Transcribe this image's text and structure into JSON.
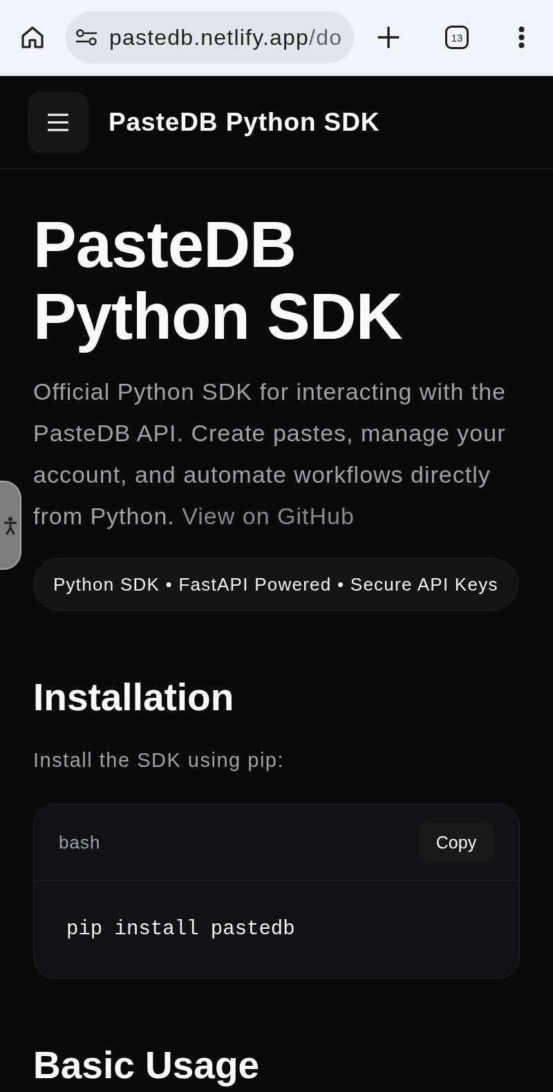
{
  "browser": {
    "url": {
      "host": "pastedb.netlify.app",
      "path": "/do"
    },
    "tab_count": "13"
  },
  "header": {
    "title": "PasteDB Python SDK"
  },
  "hero": {
    "title": "PasteDB Python SDK",
    "description": "Official Python SDK for interacting with the PasteDB API. Create pastes, manage your account, and automate workflows directly from Python.",
    "link": "View on GitHub",
    "badge": "Python SDK • FastAPI Powered • Secure API Keys"
  },
  "sections": [
    {
      "heading": "Installation",
      "text": "Install the SDK using pip:",
      "code": {
        "language": "bash",
        "copy_label": "Copy",
        "lines": [
          "pip install pastedb"
        ]
      }
    },
    {
      "heading": "Basic Usage"
    }
  ]
}
